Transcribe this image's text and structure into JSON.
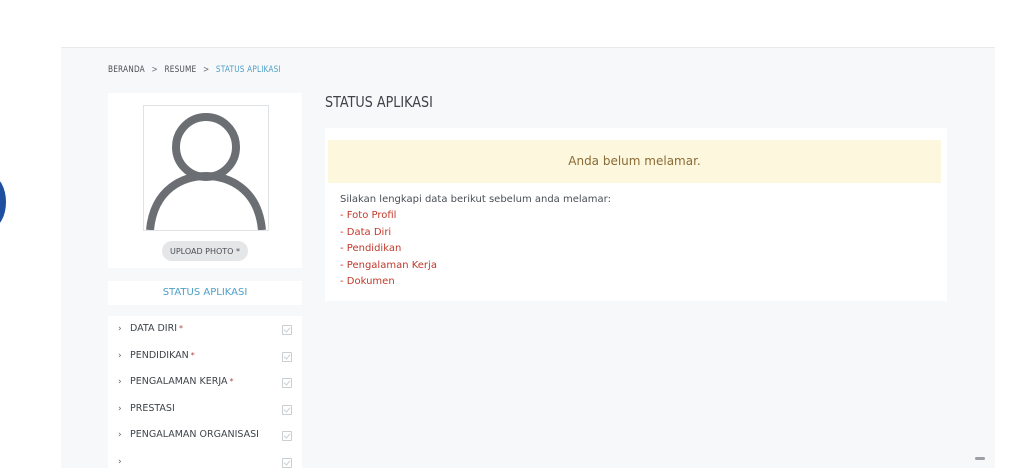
{
  "breadcrumb": {
    "items": [
      "BERANDA",
      "RESUME",
      "STATUS APLIKASI"
    ],
    "separator": ">"
  },
  "profile": {
    "upload_label": "UPLOAD PHOTO *"
  },
  "sidebar": {
    "status_tab": "STATUS APLIKASI",
    "items": [
      {
        "label": "DATA DIRI",
        "required": "*"
      },
      {
        "label": "PENDIDIKAN",
        "required": "*"
      },
      {
        "label": "PENGALAMAN KERJA",
        "required": "*"
      },
      {
        "label": "PRESTASI",
        "required": ""
      },
      {
        "label": "PENGALAMAN ORGANISASI",
        "required": ""
      },
      {
        "label": "",
        "required": ""
      }
    ]
  },
  "main": {
    "title": "STATUS APLIKASI",
    "alert": "Anda belum melamar.",
    "intro": "Silakan lengkapi data berikut sebelum anda melamar:",
    "requirements": [
      "- Foto Profil",
      "- Data Diri",
      "- Pendidikan",
      "- Pengalaman Kerja",
      "- Dokumen"
    ]
  },
  "colors": {
    "accent": "#4fa0c8",
    "alert_bg": "#fcf7dd",
    "alert_text": "#8a6b35",
    "link_red": "#c0392b",
    "page_bg": "#f7f8f9"
  },
  "icons": {
    "avatar": "user-silhouette-icon",
    "chevron": "chevron-right-icon",
    "check": "check-square-icon"
  }
}
